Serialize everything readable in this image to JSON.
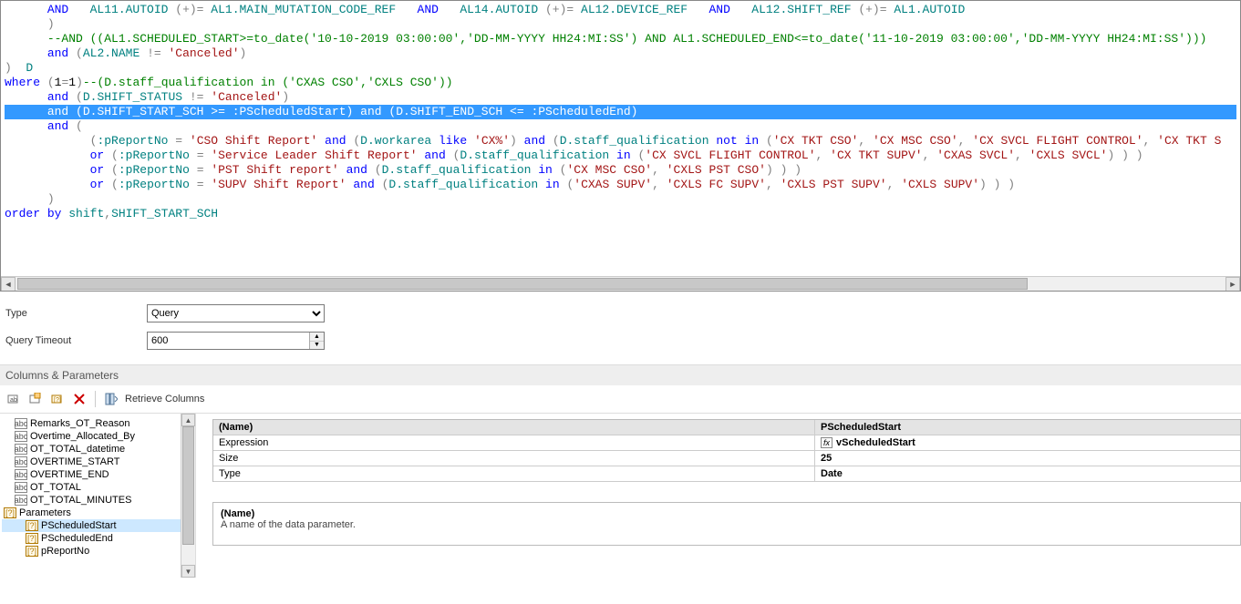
{
  "sql_tokens": [
    [
      {
        "t": "pln",
        "v": "      "
      },
      {
        "t": "kw",
        "v": "AND"
      },
      {
        "t": "pln",
        "v": "   "
      },
      {
        "t": "id",
        "v": "AL11.AUTOID"
      },
      {
        "t": "pln",
        "v": " "
      },
      {
        "t": "op",
        "v": "(+)="
      },
      {
        "t": "pln",
        "v": " "
      },
      {
        "t": "id",
        "v": "AL1.MAIN_MUTATION_CODE_REF"
      },
      {
        "t": "pln",
        "v": "   "
      },
      {
        "t": "kw",
        "v": "AND"
      },
      {
        "t": "pln",
        "v": "   "
      },
      {
        "t": "id",
        "v": "AL14.AUTOID"
      },
      {
        "t": "pln",
        "v": " "
      },
      {
        "t": "op",
        "v": "(+)="
      },
      {
        "t": "pln",
        "v": " "
      },
      {
        "t": "id",
        "v": "AL12.DEVICE_REF"
      },
      {
        "t": "pln",
        "v": "   "
      },
      {
        "t": "kw",
        "v": "AND"
      },
      {
        "t": "pln",
        "v": "   "
      },
      {
        "t": "id",
        "v": "AL12.SHIFT_REF"
      },
      {
        "t": "pln",
        "v": " "
      },
      {
        "t": "op",
        "v": "(+)="
      },
      {
        "t": "pln",
        "v": " "
      },
      {
        "t": "id",
        "v": "AL1.AUTOID"
      }
    ],
    [
      {
        "t": "pln",
        "v": "      "
      },
      {
        "t": "op",
        "v": ")"
      }
    ],
    [
      {
        "t": "pln",
        "v": "      "
      },
      {
        "t": "cmt",
        "v": "--AND ((AL1.SCHEDULED_START>=to_date('10-10-2019 03:00:00','DD-MM-YYYY HH24:MI:SS') AND AL1.SCHEDULED_END<=to_date('11-10-2019 03:00:00','DD-MM-YYYY HH24:MI:SS')))"
      }
    ],
    [
      {
        "t": "pln",
        "v": "      "
      },
      {
        "t": "kw",
        "v": "and"
      },
      {
        "t": "pln",
        "v": " "
      },
      {
        "t": "op",
        "v": "("
      },
      {
        "t": "id",
        "v": "AL2.NAME"
      },
      {
        "t": "pln",
        "v": " "
      },
      {
        "t": "op",
        "v": "!="
      },
      {
        "t": "pln",
        "v": " "
      },
      {
        "t": "str",
        "v": "'Canceled'"
      },
      {
        "t": "op",
        "v": ")"
      }
    ],
    [
      {
        "t": "op",
        "v": ")"
      },
      {
        "t": "pln",
        "v": "  "
      },
      {
        "t": "id",
        "v": "D"
      }
    ],
    [
      {
        "t": "kw",
        "v": "where"
      },
      {
        "t": "pln",
        "v": " "
      },
      {
        "t": "op",
        "v": "("
      },
      {
        "t": "num",
        "v": "1"
      },
      {
        "t": "op",
        "v": "="
      },
      {
        "t": "num",
        "v": "1"
      },
      {
        "t": "op",
        "v": ")"
      },
      {
        "t": "cmt",
        "v": "--(D.staff_qualification in ('CXAS CSO','CXLS CSO'))"
      }
    ],
    [
      {
        "t": "pln",
        "v": ""
      }
    ],
    [
      {
        "t": "pln",
        "v": "      "
      },
      {
        "t": "kw",
        "v": "and"
      },
      {
        "t": "pln",
        "v": " "
      },
      {
        "t": "op",
        "v": "("
      },
      {
        "t": "id",
        "v": "D.SHIFT_STATUS"
      },
      {
        "t": "pln",
        "v": " "
      },
      {
        "t": "op",
        "v": "!="
      },
      {
        "t": "pln",
        "v": " "
      },
      {
        "t": "str",
        "v": "'Canceled'"
      },
      {
        "t": "op",
        "v": ")"
      }
    ],
    [
      {
        "t": "pln",
        "v": "      "
      },
      {
        "t": "kw",
        "v": "and"
      },
      {
        "t": "pln",
        "v": " "
      },
      {
        "t": "op",
        "v": "("
      },
      {
        "t": "id",
        "v": "D.SHIFT_START_SCH"
      },
      {
        "t": "pln",
        "v": " "
      },
      {
        "t": "op",
        "v": ">="
      },
      {
        "t": "pln",
        "v": " "
      },
      {
        "t": "id",
        "v": ":PScheduledStart"
      },
      {
        "t": "op",
        "v": ")"
      },
      {
        "t": "pln",
        "v": " "
      },
      {
        "t": "kw",
        "v": "and"
      },
      {
        "t": "pln",
        "v": " "
      },
      {
        "t": "op",
        "v": "("
      },
      {
        "t": "id",
        "v": "D.SHIFT_END_SCH"
      },
      {
        "t": "pln",
        "v": " "
      },
      {
        "t": "op",
        "v": "<="
      },
      {
        "t": "pln",
        "v": " "
      },
      {
        "t": "id",
        "v": ":PScheduledEnd"
      },
      {
        "t": "op",
        "v": ")"
      }
    ],
    [
      {
        "t": "pln",
        "v": "      "
      },
      {
        "t": "kw",
        "v": "and"
      },
      {
        "t": "pln",
        "v": " "
      },
      {
        "t": "op",
        "v": "("
      }
    ],
    [
      {
        "t": "pln",
        "v": "            "
      },
      {
        "t": "op",
        "v": "("
      },
      {
        "t": "id",
        "v": ":pReportNo"
      },
      {
        "t": "pln",
        "v": " "
      },
      {
        "t": "op",
        "v": "="
      },
      {
        "t": "pln",
        "v": " "
      },
      {
        "t": "str",
        "v": "'CSO Shift Report'"
      },
      {
        "t": "pln",
        "v": " "
      },
      {
        "t": "kw",
        "v": "and"
      },
      {
        "t": "pln",
        "v": " "
      },
      {
        "t": "op",
        "v": "("
      },
      {
        "t": "id",
        "v": "D.workarea"
      },
      {
        "t": "pln",
        "v": " "
      },
      {
        "t": "kw",
        "v": "like"
      },
      {
        "t": "pln",
        "v": " "
      },
      {
        "t": "str",
        "v": "'CX%'"
      },
      {
        "t": "op",
        "v": ")"
      },
      {
        "t": "pln",
        "v": " "
      },
      {
        "t": "kw",
        "v": "and"
      },
      {
        "t": "pln",
        "v": " "
      },
      {
        "t": "op",
        "v": "("
      },
      {
        "t": "id",
        "v": "D.staff_qualification"
      },
      {
        "t": "pln",
        "v": " "
      },
      {
        "t": "kw",
        "v": "not"
      },
      {
        "t": "pln",
        "v": " "
      },
      {
        "t": "kw",
        "v": "in"
      },
      {
        "t": "pln",
        "v": " "
      },
      {
        "t": "op",
        "v": "("
      },
      {
        "t": "str",
        "v": "'CX TKT CSO'"
      },
      {
        "t": "op",
        "v": ","
      },
      {
        "t": "pln",
        "v": " "
      },
      {
        "t": "str",
        "v": "'CX MSC CSO'"
      },
      {
        "t": "op",
        "v": ","
      },
      {
        "t": "pln",
        "v": " "
      },
      {
        "t": "str",
        "v": "'CX SVCL FLIGHT CONTROL'"
      },
      {
        "t": "op",
        "v": ","
      },
      {
        "t": "pln",
        "v": " "
      },
      {
        "t": "str",
        "v": "'CX TKT S"
      }
    ],
    [
      {
        "t": "pln",
        "v": "            "
      },
      {
        "t": "kw",
        "v": "or"
      },
      {
        "t": "pln",
        "v": " "
      },
      {
        "t": "op",
        "v": "("
      },
      {
        "t": "id",
        "v": ":pReportNo"
      },
      {
        "t": "pln",
        "v": " "
      },
      {
        "t": "op",
        "v": "="
      },
      {
        "t": "pln",
        "v": " "
      },
      {
        "t": "str",
        "v": "'Service Leader Shift Report'"
      },
      {
        "t": "pln",
        "v": " "
      },
      {
        "t": "kw",
        "v": "and"
      },
      {
        "t": "pln",
        "v": " "
      },
      {
        "t": "op",
        "v": "("
      },
      {
        "t": "id",
        "v": "D.staff_qualification"
      },
      {
        "t": "pln",
        "v": " "
      },
      {
        "t": "kw",
        "v": "in"
      },
      {
        "t": "pln",
        "v": " "
      },
      {
        "t": "op",
        "v": "("
      },
      {
        "t": "str",
        "v": "'CX SVCL FLIGHT CONTROL'"
      },
      {
        "t": "op",
        "v": ","
      },
      {
        "t": "pln",
        "v": " "
      },
      {
        "t": "str",
        "v": "'CX TKT SUPV'"
      },
      {
        "t": "op",
        "v": ","
      },
      {
        "t": "pln",
        "v": " "
      },
      {
        "t": "str",
        "v": "'CXAS SVCL'"
      },
      {
        "t": "op",
        "v": ","
      },
      {
        "t": "pln",
        "v": " "
      },
      {
        "t": "str",
        "v": "'CXLS SVCL'"
      },
      {
        "t": "op",
        "v": ")"
      },
      {
        "t": "pln",
        "v": " "
      },
      {
        "t": "op",
        "v": ")"
      },
      {
        "t": "pln",
        "v": " "
      },
      {
        "t": "op",
        "v": ")"
      }
    ],
    [
      {
        "t": "pln",
        "v": "            "
      },
      {
        "t": "kw",
        "v": "or"
      },
      {
        "t": "pln",
        "v": " "
      },
      {
        "t": "op",
        "v": "("
      },
      {
        "t": "id",
        "v": ":pReportNo"
      },
      {
        "t": "pln",
        "v": " "
      },
      {
        "t": "op",
        "v": "="
      },
      {
        "t": "pln",
        "v": " "
      },
      {
        "t": "str",
        "v": "'PST Shift report'"
      },
      {
        "t": "pln",
        "v": " "
      },
      {
        "t": "kw",
        "v": "and"
      },
      {
        "t": "pln",
        "v": " "
      },
      {
        "t": "op",
        "v": "("
      },
      {
        "t": "id",
        "v": "D.staff_qualification"
      },
      {
        "t": "pln",
        "v": " "
      },
      {
        "t": "kw",
        "v": "in"
      },
      {
        "t": "pln",
        "v": " "
      },
      {
        "t": "op",
        "v": "("
      },
      {
        "t": "str",
        "v": "'CX MSC CSO'"
      },
      {
        "t": "op",
        "v": ","
      },
      {
        "t": "pln",
        "v": " "
      },
      {
        "t": "str",
        "v": "'CXLS PST CSO'"
      },
      {
        "t": "op",
        "v": ")"
      },
      {
        "t": "pln",
        "v": " "
      },
      {
        "t": "op",
        "v": ")"
      },
      {
        "t": "pln",
        "v": " "
      },
      {
        "t": "op",
        "v": ")"
      }
    ],
    [
      {
        "t": "pln",
        "v": "            "
      },
      {
        "t": "kw",
        "v": "or"
      },
      {
        "t": "pln",
        "v": " "
      },
      {
        "t": "op",
        "v": "("
      },
      {
        "t": "id",
        "v": ":pReportNo"
      },
      {
        "t": "pln",
        "v": " "
      },
      {
        "t": "op",
        "v": "="
      },
      {
        "t": "pln",
        "v": " "
      },
      {
        "t": "str",
        "v": "'SUPV Shift Report'"
      },
      {
        "t": "pln",
        "v": " "
      },
      {
        "t": "kw",
        "v": "and"
      },
      {
        "t": "pln",
        "v": " "
      },
      {
        "t": "op",
        "v": "("
      },
      {
        "t": "id",
        "v": "D.staff_qualification"
      },
      {
        "t": "pln",
        "v": " "
      },
      {
        "t": "kw",
        "v": "in"
      },
      {
        "t": "pln",
        "v": " "
      },
      {
        "t": "op",
        "v": "("
      },
      {
        "t": "str",
        "v": "'CXAS SUPV'"
      },
      {
        "t": "op",
        "v": ","
      },
      {
        "t": "pln",
        "v": " "
      },
      {
        "t": "str",
        "v": "'CXLS FC SUPV'"
      },
      {
        "t": "op",
        "v": ","
      },
      {
        "t": "pln",
        "v": " "
      },
      {
        "t": "str",
        "v": "'CXLS PST SUPV'"
      },
      {
        "t": "op",
        "v": ","
      },
      {
        "t": "pln",
        "v": " "
      },
      {
        "t": "str",
        "v": "'CXLS SUPV'"
      },
      {
        "t": "op",
        "v": ")"
      },
      {
        "t": "pln",
        "v": " "
      },
      {
        "t": "op",
        "v": ")"
      },
      {
        "t": "pln",
        "v": " "
      },
      {
        "t": "op",
        "v": ")"
      }
    ],
    [
      {
        "t": "pln",
        "v": "      "
      },
      {
        "t": "op",
        "v": ")"
      }
    ],
    [
      {
        "t": "pln",
        "v": ""
      }
    ],
    [
      {
        "t": "kw",
        "v": "order"
      },
      {
        "t": "pln",
        "v": " "
      },
      {
        "t": "kw",
        "v": "by"
      },
      {
        "t": "pln",
        "v": " "
      },
      {
        "t": "id",
        "v": "shift"
      },
      {
        "t": "op",
        "v": ","
      },
      {
        "t": "id",
        "v": "SHIFT_START_SCH"
      }
    ]
  ],
  "highlight_line_index": 8,
  "controls": {
    "type_label": "Type",
    "type_value": "Query",
    "timeout_label": "Query Timeout",
    "timeout_value": "600"
  },
  "section_header": "Columns & Parameters",
  "toolbar": {
    "retrieve_label": "Retrieve Columns"
  },
  "tree": {
    "columns": [
      "Remarks_OT_Reason",
      "Overtime_Allocated_By",
      "OT_TOTAL_datetime",
      "OVERTIME_START",
      "OVERTIME_END",
      "OT_TOTAL",
      "OT_TOTAL_MINUTES"
    ],
    "parameters_label": "Parameters",
    "parameters": [
      "PScheduledStart",
      "PScheduledEnd",
      "pReportNo"
    ],
    "selected_parameter_index": 0
  },
  "props": {
    "header_key": "(Name)",
    "header_val": "PScheduledStart",
    "rows": [
      {
        "key": "Expression",
        "val": "vScheduledStart",
        "fx": true
      },
      {
        "key": "Size",
        "val": "25"
      },
      {
        "key": "Type",
        "val": "Date"
      }
    ]
  },
  "help": {
    "title": "(Name)",
    "desc": "A name of the data parameter."
  }
}
